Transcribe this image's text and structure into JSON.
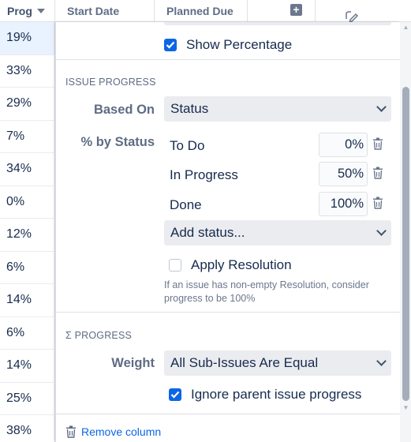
{
  "grid": {
    "columns": [
      {
        "label": "Prog"
      },
      {
        "label": "Start Date"
      },
      {
        "label": "Planned Due"
      }
    ],
    "progress_values": [
      "19%",
      "33%",
      "29%",
      "7%",
      "34%",
      "0%",
      "12%",
      "6%",
      "14%",
      "6%",
      "14%",
      "25%",
      "38%"
    ]
  },
  "panel": {
    "show_percentage": {
      "label": "Show Percentage",
      "checked": true
    },
    "issue_progress": {
      "title": "ISSUE PROGRESS",
      "based_on_label": "Based On",
      "based_on_value": "Status",
      "by_status_label": "% by Status",
      "statuses": [
        {
          "name": "To Do",
          "percent": "0%"
        },
        {
          "name": "In Progress",
          "percent": "50%"
        },
        {
          "name": "Done",
          "percent": "100%"
        }
      ],
      "add_status_placeholder": "Add status...",
      "apply_resolution": {
        "label": "Apply Resolution",
        "checked": false
      },
      "helper_text_1": "If an issue has non-empty Resolution, consider",
      "helper_text_2": "progress to be 100%"
    },
    "sigma_progress": {
      "title": "Σ PROGRESS",
      "weight_label": "Weight",
      "weight_value": "All Sub-Issues Are Equal",
      "ignore_parent": {
        "label": "Ignore parent issue progress",
        "checked": true
      }
    },
    "remove_column_label": "Remove column"
  },
  "colors": {
    "accent": "#0c66e4",
    "select_bg": "#ebecf0",
    "selected_row": "#e9f2ff",
    "muted_text": "#5e6c84"
  }
}
